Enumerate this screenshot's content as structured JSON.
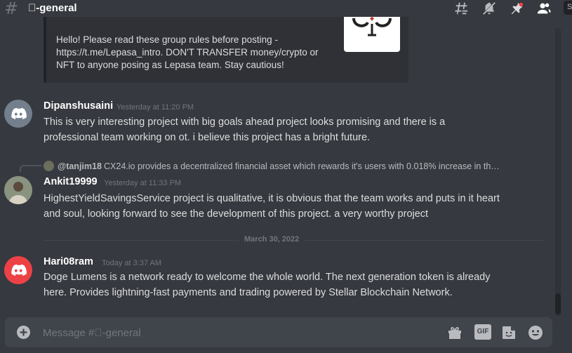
{
  "header": {
    "channel_name": "\u0000-general",
    "icons": [
      "threads-icon",
      "mute-bell-icon",
      "pin-icon",
      "members-icon",
      "search-icon"
    ]
  },
  "embed": {
    "text": "Hello! Please read these group rules before posting - https://t.me/Lepasa_intro. DON'T TRANSFER money/crypto or NFT to anyone posing as Lepasa team. Stay cautious!"
  },
  "messages": [
    {
      "username": "Dipanshusaini",
      "timestamp": "Yesterday at 11:20 PM",
      "text": "This is very interesting project with big goals ahead project looks promising and there is a professional team working on ot. i believe this project has a bright future."
    },
    {
      "reply": {
        "user": "@tanjim18",
        "text": "CX24.io provides a decentralized financial asset which rewards it's users with 0.018% increase in th…"
      },
      "username": "Ankit19999",
      "timestamp": "Yesterday at 11:33 PM",
      "text": "HighestYieldSavingsService  project is qualitative, it is obvious that the team works and puts in it heart and soul, looking forward to see the development of this project. a very worthy project"
    },
    {
      "username": "Hari08ram",
      "timestamp": "Today at 3:37 AM",
      "text": "Doge Lumens is a network ready to welcome the whole world. The next generation token is already here. Provides lightning-fast payments and trading powered by Stellar Blockchain Network."
    }
  ],
  "date_divider": "March 30, 2022",
  "composer": {
    "placeholder": "Message #\u0000-general",
    "gif_label": "GIF"
  },
  "search_stub": "S",
  "colors": {
    "background": "#36393f",
    "embed_bg": "#2f3136",
    "composer_bg": "#40444b",
    "avatar_grey": "#747f8d",
    "avatar_red": "#ed4245"
  }
}
